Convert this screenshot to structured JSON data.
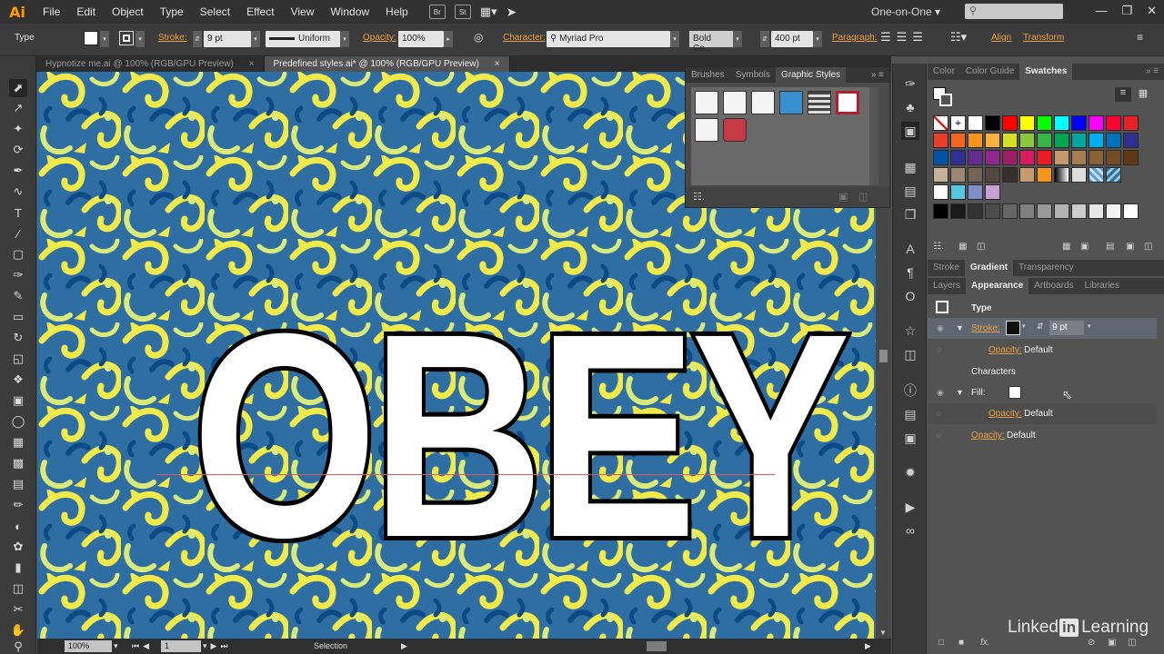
{
  "app": {
    "logo": "Ai",
    "workspace": "One-on-One ▾"
  },
  "menu": [
    "File",
    "Edit",
    "Object",
    "Type",
    "Select",
    "Effect",
    "View",
    "Window",
    "Help"
  ],
  "menu_icons": [
    "Br",
    "St"
  ],
  "control": {
    "type_label": "Type",
    "stroke_label": "Stroke:",
    "stroke_weight": "9 pt",
    "profile": "Uniform",
    "opacity_label": "Opacity:",
    "opacity_value": "100%",
    "character_label": "Character:",
    "font": "Myriad Pro",
    "style": "Bold Co...",
    "size": "400 pt",
    "paragraph_label": "Paragraph:",
    "align": "Align",
    "transform": "Transform"
  },
  "tabs": [
    {
      "label": "Hypnotize me.ai @ 100% (RGB/GPU Preview)",
      "close": "×"
    },
    {
      "label": "Predefined styles.ai* @ 100% (RGB/GPU Preview)",
      "close": "×"
    }
  ],
  "canvas": {
    "text": "OBEY"
  },
  "status": {
    "zoom": "100%",
    "artboard": "1",
    "tool": "Selection"
  },
  "graphic_styles_panel": {
    "tabs": [
      "Brushes",
      "Symbols",
      "Graphic Styles"
    ]
  },
  "color_panel": {
    "tabs": [
      "Color",
      "Color Guide",
      "Swatches"
    ]
  },
  "stroke_panel": {
    "tabs": [
      "Stroke",
      "Gradient",
      "Transparency"
    ]
  },
  "appearance_panel": {
    "tabs": [
      "Layers",
      "Appearance",
      "Artboards",
      "Libraries"
    ],
    "object": "Type",
    "stroke_label": "Stroke:",
    "stroke_weight": "9 pt",
    "opacity_label": "Opacity:",
    "opacity_default": "Default",
    "characters": "Characters",
    "fill_label": "Fill:"
  },
  "watermark": {
    "pre": "Linked",
    "in": "in",
    "post": "Learning"
  },
  "colors": {
    "accent_orange": "#e9a044",
    "pattern_blue": "#2f6ea3",
    "pattern_yellow": "#f0e94a"
  }
}
